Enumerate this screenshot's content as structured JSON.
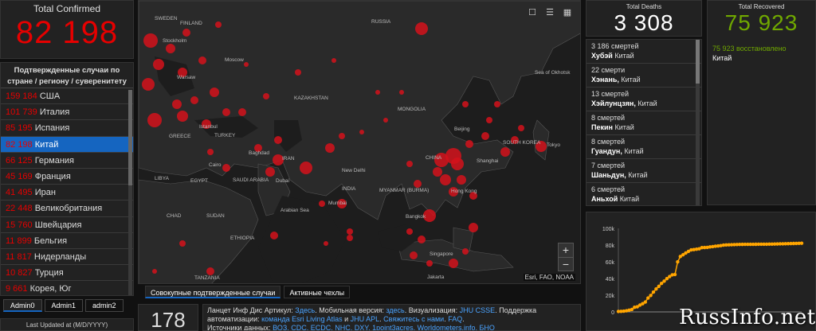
{
  "confirmed": {
    "label": "Total Confirmed",
    "value": "82 198"
  },
  "countries": {
    "header": "Подтвержденные случаи по стране / региону / суверенитету",
    "items": [
      {
        "count": "159 184",
        "name": "США"
      },
      {
        "count": "101 739",
        "name": "Италия"
      },
      {
        "count": "85 195",
        "name": "Испания"
      },
      {
        "count": "82 198",
        "name": "Китай"
      },
      {
        "count": "66 125",
        "name": "Германия"
      },
      {
        "count": "45 169",
        "name": "Франция"
      },
      {
        "count": "41 495",
        "name": "Иран"
      },
      {
        "count": "22 448",
        "name": "Великобритания"
      },
      {
        "count": "15 760",
        "name": "Швейцария"
      },
      {
        "count": "11 899",
        "name": "Бельгия"
      },
      {
        "count": "11 817",
        "name": "Нидерланды"
      },
      {
        "count": "10 827",
        "name": "Турция"
      },
      {
        "count": "9 661",
        "name": "Корея, Юг"
      }
    ]
  },
  "admin_tabs": [
    "Admin0",
    "Admin1",
    "admin2"
  ],
  "last_updated": "Last Updated at (M/D/YYYY)",
  "map": {
    "labels": [
      "SWEDEN",
      "FINLAND",
      "RUSSIA",
      "Stockholm",
      "Moscow",
      "Warsaw",
      "KAZAKHSTAN",
      "MONGOLIA",
      "Sea of Okhotsk",
      "Istanbul",
      "TURKEY",
      "GREECE",
      "Tokyo",
      "SOUTH KOREA",
      "Beijing",
      "Shanghai",
      "CHINA",
      "Baghdad",
      "IRAN",
      "Cairo",
      "LIBYA",
      "EGYPT",
      "SAUDI ARABIA",
      "Dubai",
      "New Delhi",
      "INDIA",
      "Arabian Sea",
      "Mumbai",
      "MYANMAR (BURMA)",
      "Hong Kong",
      "Bangkok",
      "CHAD",
      "SUDAN",
      "ETHIOPIA",
      "Singapore",
      "TANZANIA",
      "Jakarta"
    ],
    "attribution": "Esri, FAO, NOAA",
    "tabs": [
      "Совокупные подтвержденные случаи",
      "Активные чехлы"
    ]
  },
  "bottom": {
    "count": "178",
    "info": {
      "p1": "Ланцет Инф Дис Артикул: ",
      "l1": "Здесь",
      "p2": ". Мобильная версия: ",
      "l2": "здесь",
      "p3": ". Визуализация: ",
      "l3": "JHU CSSE",
      "p4": ". Поддержка автоматизации: ",
      "l4": "команда Esri Living Atlas",
      "p5": " и ",
      "l5": "JHU APL",
      "p6": ". ",
      "l6": "Свяжитесь с нами",
      "p7": ". ",
      "l7": "FAQ",
      "p8": ".",
      "p9": "Источники данных: ",
      "l9": "ВОЗ, CDC, ECDC, NHC, DXY, 1point3acres, Worldometers.info, БНО"
    }
  },
  "deaths": {
    "label": "Total Deaths",
    "value": "3 308",
    "items": [
      {
        "count": "3 186",
        "unit": "смертей",
        "place": "Хубэй",
        "country": "Китай"
      },
      {
        "count": "22",
        "unit": "смерти",
        "place": "Хэнань,",
        "country": "Китай"
      },
      {
        "count": "13",
        "unit": "смертей",
        "place": "Хэйлунцзян,",
        "country": "Китай"
      },
      {
        "count": "8",
        "unit": "смертей",
        "place": "Пекин",
        "country": "Китай"
      },
      {
        "count": "8",
        "unit": "смертей",
        "place": "Гуандун,",
        "country": "Китай"
      },
      {
        "count": "7",
        "unit": "смертей",
        "place": "Шаньдун,",
        "country": "Китай"
      },
      {
        "count": "6",
        "unit": "смертей",
        "place": "Аньхой",
        "country": "Китай"
      }
    ]
  },
  "recovered": {
    "label": "Total Recovered",
    "value": "75 923",
    "sub_count": "75 923",
    "sub_text": "восстановлено",
    "sub_country": "Китай"
  },
  "chart_data": {
    "type": "line",
    "x": [
      0,
      1,
      2,
      3,
      4,
      5,
      6,
      7,
      8,
      9,
      10,
      11,
      12,
      13,
      14,
      15,
      16,
      17,
      18,
      19,
      20,
      21,
      22,
      23,
      24,
      25,
      26,
      27,
      28,
      29,
      30,
      31,
      32,
      33,
      34,
      35,
      36,
      37,
      38,
      39,
      40,
      41,
      42,
      43,
      44,
      45,
      46,
      47,
      48,
      49,
      50,
      51,
      52,
      53,
      54,
      55,
      56,
      57,
      58,
      59,
      60,
      61,
      62,
      63,
      64,
      65,
      66,
      67,
      68
    ],
    "values": [
      548,
      643,
      920,
      1406,
      2075,
      2877,
      5509,
      6087,
      8141,
      9802,
      11891,
      16630,
      19716,
      23707,
      27440,
      30587,
      34110,
      36814,
      39829,
      42354,
      44386,
      44759,
      59895,
      66358,
      68413,
      70513,
      72434,
      74211,
      74619,
      75077,
      75550,
      77001,
      77022,
      77241,
      77754,
      78166,
      78600,
      78928,
      79356,
      79932,
      80136,
      80261,
      80386,
      80537,
      80690,
      80770,
      80823,
      80860,
      80887,
      80921,
      80932,
      80945,
      80977,
      81003,
      81033,
      81058,
      81102,
      81156,
      81250,
      81305,
      81435,
      81498,
      81591,
      81661,
      81782,
      81897,
      81999,
      82122,
      82198
    ],
    "yticks": [
      "0",
      "20k",
      "40k",
      "60k",
      "80k",
      "100k"
    ],
    "ylim": [
      0,
      100000
    ],
    "color": "#ffa500",
    "grid": false
  },
  "watermark": "RussInfo.net"
}
